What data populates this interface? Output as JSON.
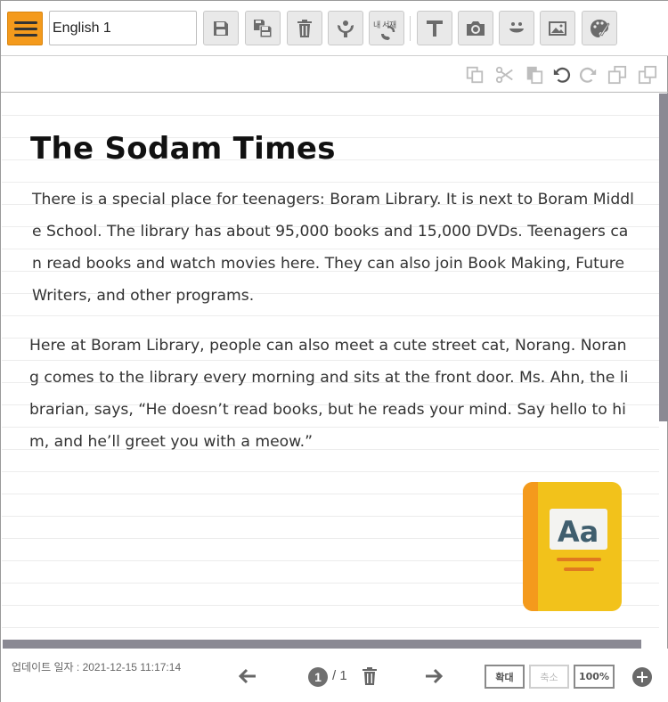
{
  "toolbar": {
    "title_value": "English 1",
    "buttons": [
      {
        "name": "save-icon"
      },
      {
        "name": "save-as-icon"
      },
      {
        "name": "trash-icon"
      },
      {
        "name": "share-icon"
      },
      {
        "name": "bookshelf-icon",
        "label": "내 서재"
      },
      {
        "name": "text-icon"
      },
      {
        "name": "camera-icon"
      },
      {
        "name": "emoji-icon"
      },
      {
        "name": "image-icon"
      },
      {
        "name": "palette-icon"
      }
    ]
  },
  "edit_bar": {
    "icons": [
      "copy-icon",
      "cut-icon",
      "paste-icon",
      "undo-icon",
      "redo-icon",
      "bring-front-icon",
      "send-back-icon"
    ]
  },
  "document": {
    "title": "The Sodam Times",
    "paragraphs": [
      "There is a special place for teenagers: Boram Library. It is next to Boram Middle School. The library has about 95,000 books and 15,000 DVDs. Teenagers can read books and watch movies here. They can also join Book Making, Future Writers, and other programs.",
      "Here at Boram Library, people can also meet a cute street cat, Norang. Norang comes to the library every morning and sits at the front door. Ms. Ahn, the librarian, says, “He doesn’t read books, but he reads your mind. Say hello to him, and he’ll greet you with a meow.”"
    ],
    "sticker": {
      "name": "dictionary-book-icon",
      "text": "Aa"
    }
  },
  "footer": {
    "updated_label": "업데이트 일자 : 2021-12-15 11:17:14",
    "current_page": "1",
    "total_pages": "/ 1",
    "zoom_in_label": "확대",
    "zoom_out_label": "축소",
    "zoom_level": "100%"
  },
  "colors": {
    "accent": "#f49a1c",
    "scrollbar": "#8a8993",
    "book_cover": "#f2c21b",
    "book_spine": "#f49a1c",
    "book_label": "#3f5e6e"
  }
}
